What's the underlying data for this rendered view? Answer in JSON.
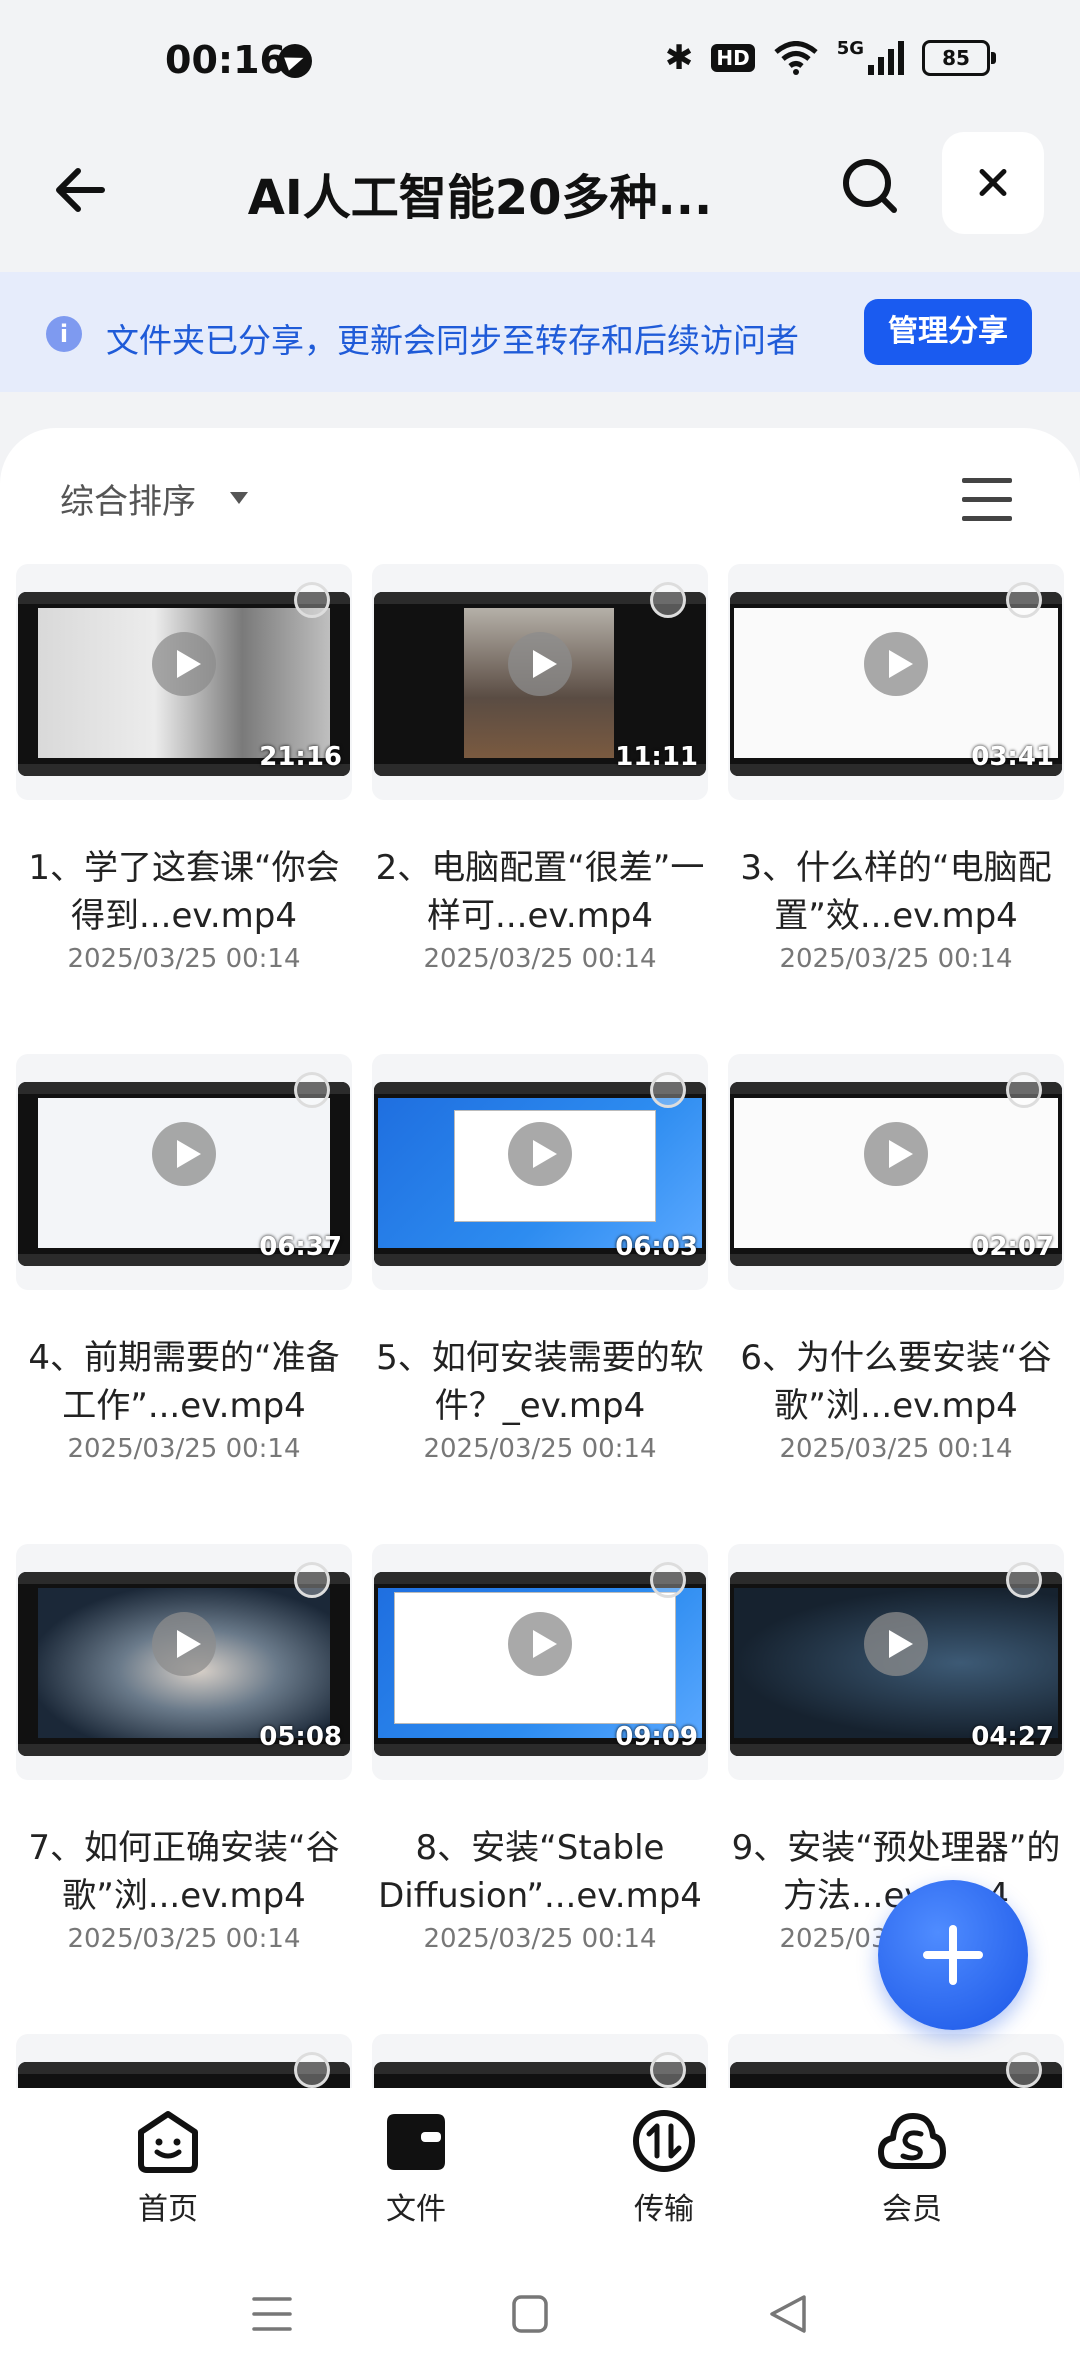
{
  "status": {
    "time": "00:16",
    "battery": "85",
    "network": "5G",
    "hd": "HD"
  },
  "header": {
    "title": "AI人工智能20多种..."
  },
  "notice": {
    "text": "文件夹已分享，更新会同步至转存和后续访问者",
    "button": "管理分享"
  },
  "toolbar": {
    "sort_label": "综合排序"
  },
  "files": [
    {
      "name": "1、学了这套课“你会得到...ev.mp4",
      "date": "2025/03/25 00:14",
      "duration": "21:16"
    },
    {
      "name": "2、电脑配置“很差”一样可...ev.mp4",
      "date": "2025/03/25 00:14",
      "duration": "11:11"
    },
    {
      "name": "3、什么样的“电脑配置”效...ev.mp4",
      "date": "2025/03/25 00:14",
      "duration": "03:41"
    },
    {
      "name": "4、前期需要的“准备工作”...ev.mp4",
      "date": "2025/03/25 00:14",
      "duration": "06:37"
    },
    {
      "name": "5、如何安装需要的软件？_ev.mp4",
      "date": "2025/03/25 00:14",
      "duration": "06:03"
    },
    {
      "name": "6、为什么要安装“谷歌”浏...ev.mp4",
      "date": "2025/03/25 00:14",
      "duration": "02:07"
    },
    {
      "name": "7、如何正确安装“谷歌”浏...ev.mp4",
      "date": "2025/03/25 00:14",
      "duration": "05:08"
    },
    {
      "name": "8、安装“Stable Diffusion”...ev.mp4",
      "date": "2025/03/25 00:14",
      "duration": "09:09"
    },
    {
      "name": "9、安装“预处理器”的方法...ev.mp4",
      "date": "2025/03/25 00:14",
      "duration": "04:27"
    }
  ],
  "nav": [
    {
      "label": "首页",
      "icon": "home-face-icon"
    },
    {
      "label": "文件",
      "icon": "folder-icon"
    },
    {
      "label": "传输",
      "icon": "transfer-icon"
    },
    {
      "label": "会员",
      "icon": "vip-cloud-icon"
    }
  ]
}
